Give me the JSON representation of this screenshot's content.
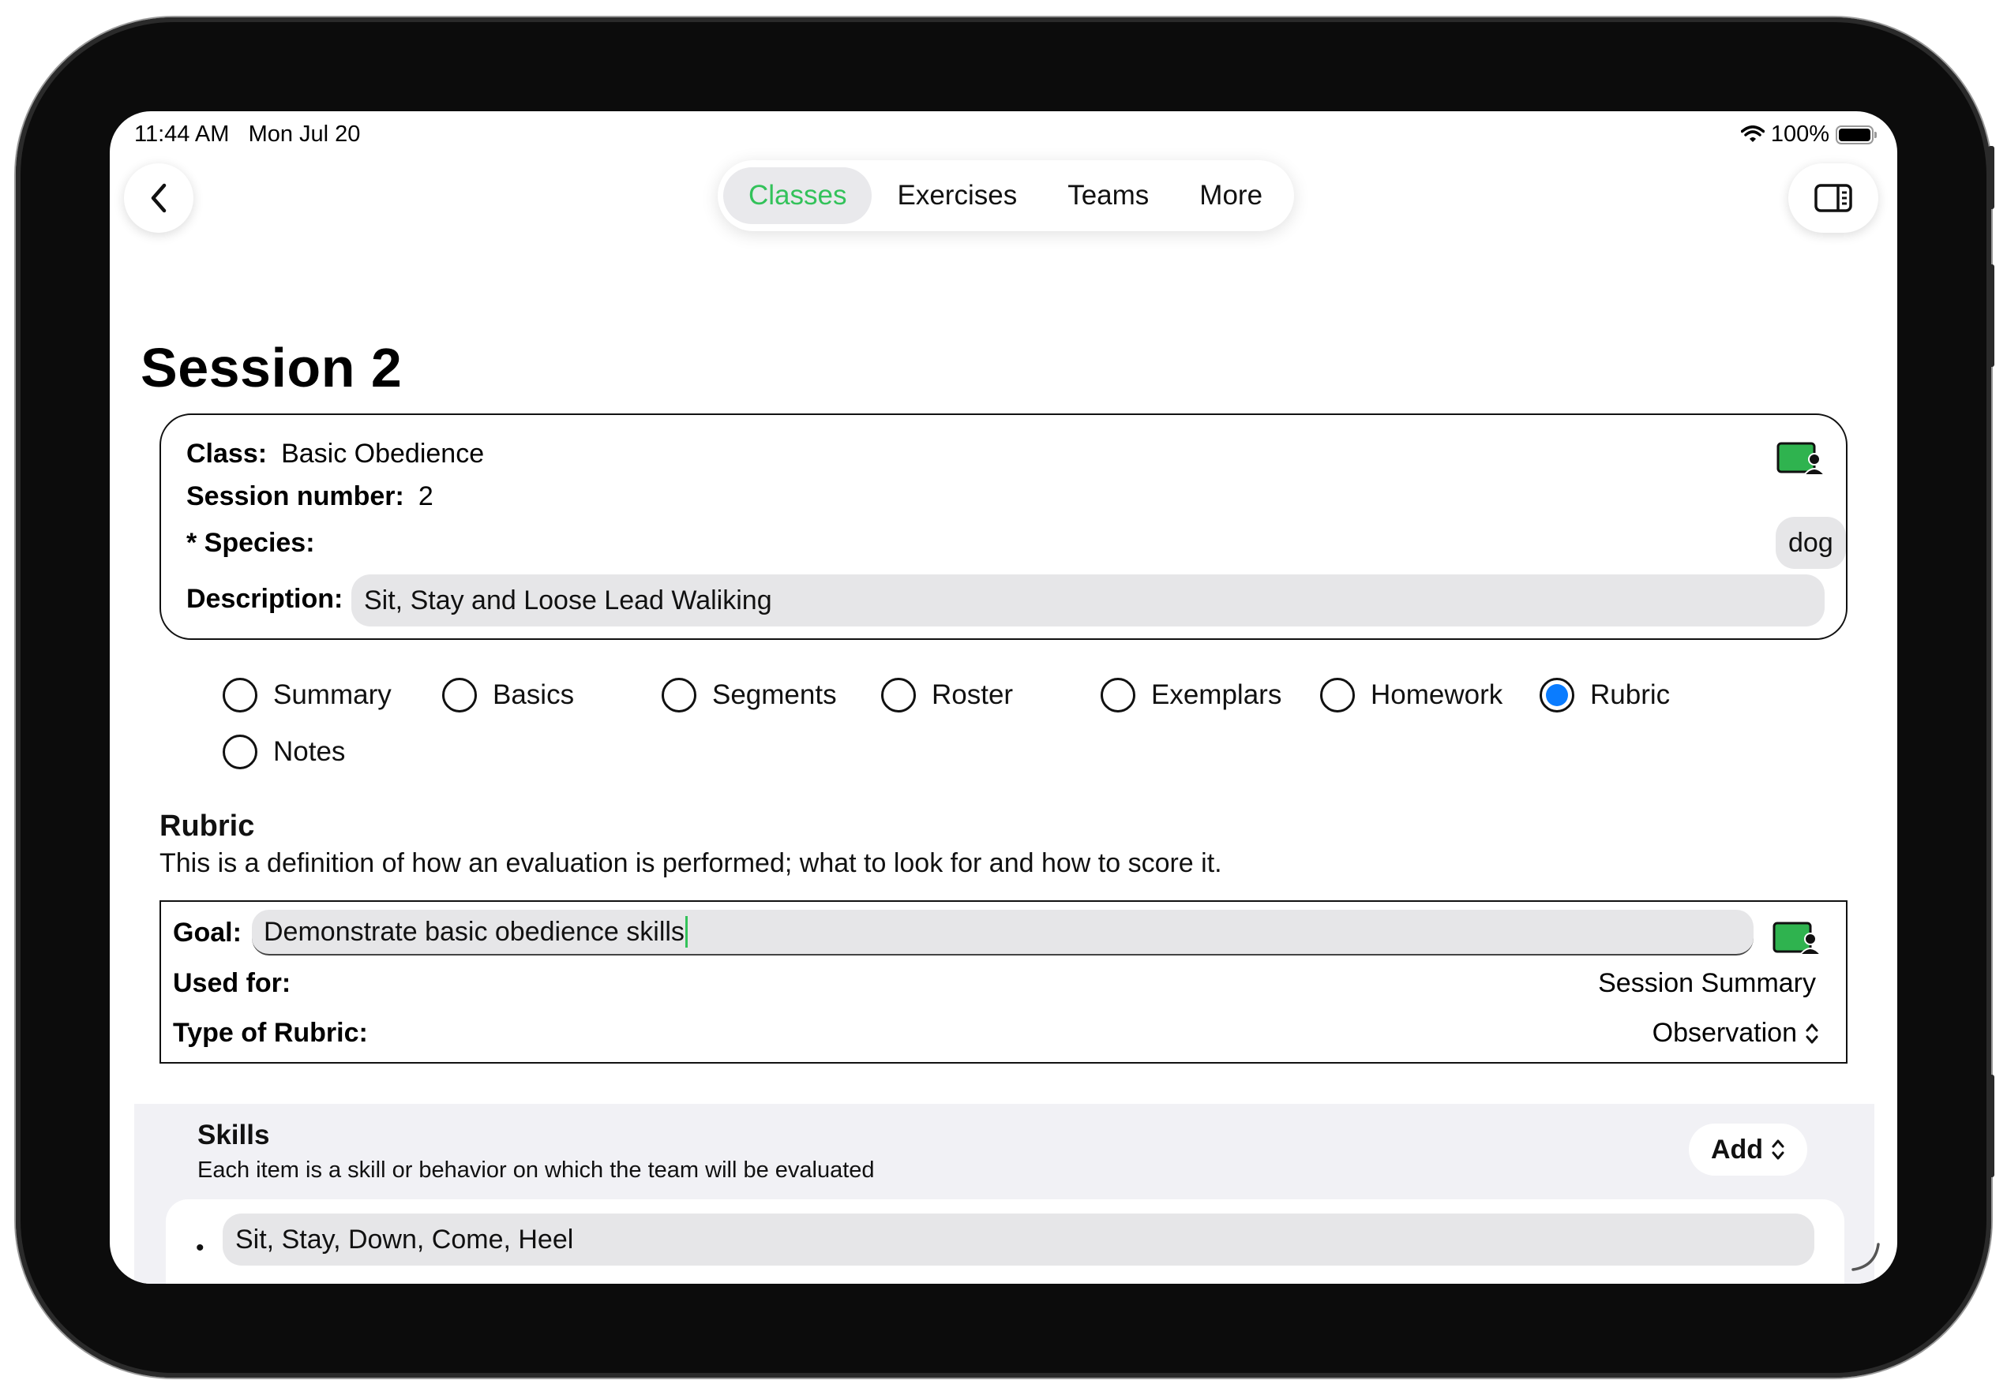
{
  "status_bar": {
    "time": "11:44 AM",
    "date": "Mon Jul 20",
    "battery": "100%"
  },
  "nav": {
    "back_icon": "chevron-left-icon",
    "tabs": [
      {
        "label": "Classes",
        "active": true
      },
      {
        "label": "Exercises",
        "active": false
      },
      {
        "label": "Teams",
        "active": false
      },
      {
        "label": "More",
        "active": false
      }
    ],
    "sidebar_icon": "sidebar-toggle-icon"
  },
  "page_title": "Session 2",
  "session": {
    "class_label": "Class:",
    "class_value": "Basic Obedience",
    "session_number_label": "Session number:",
    "session_number_value": "2",
    "species_label": "* Species:",
    "species_value": "dog",
    "description_label": "Description:",
    "description_value": "Sit, Stay and Loose Lead Waliking"
  },
  "sections": [
    {
      "label": "Summary",
      "selected": false
    },
    {
      "label": "Basics",
      "selected": false
    },
    {
      "label": "Segments",
      "selected": false
    },
    {
      "label": "Roster",
      "selected": false
    },
    {
      "label": "Exemplars",
      "selected": false
    },
    {
      "label": "Homework",
      "selected": false
    },
    {
      "label": "Rubric",
      "selected": true
    },
    {
      "label": "Notes",
      "selected": false
    }
  ],
  "rubric": {
    "heading": "Rubric",
    "description": "This is a definition of how an evaluation is performed; what to look for and how to score it.",
    "goal_label": "Goal:",
    "goal_value": "Demonstrate basic obedience skills",
    "used_for_label": "Used for:",
    "used_for_value": "Session Summary",
    "type_label": "Type of Rubric:",
    "type_value": "Observation"
  },
  "skills": {
    "title": "Skills",
    "subtitle": "Each item is a skill or behavior on which the team will be evaluated",
    "add_label": "Add",
    "items": [
      "Sit, Stay, Down, Come, Heel"
    ]
  },
  "colors": {
    "accent_green": "#33c25a",
    "radio_blue": "#0a7cff"
  }
}
